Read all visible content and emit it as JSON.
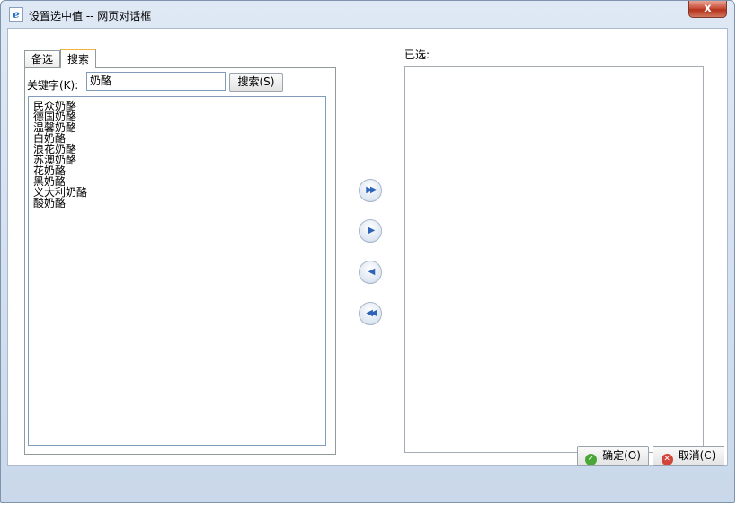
{
  "window": {
    "title": "设置选中值 -- 网页对话框",
    "close_glyph": "x"
  },
  "tabs": [
    {
      "label": "备选"
    },
    {
      "label": "搜索"
    }
  ],
  "search": {
    "keyword_label": "关键字(K):",
    "keyword_value": "奶酪",
    "button_label": "搜索(S)"
  },
  "available_items": [
    "民众奶酪",
    "德国奶酪",
    "温馨奶酪",
    "白奶酪",
    "浪花奶酪",
    "苏澳奶酪",
    "花奶酪",
    "黑奶酪",
    "义大利奶酪",
    "酸奶酪"
  ],
  "selected": {
    "label": "已选:"
  },
  "move_buttons": {
    "add_all": "▶▶",
    "add": "▶",
    "remove": "◀",
    "remove_all": "◀◀"
  },
  "footer": {
    "ok_label": "确定(O)",
    "cancel_label": "取消(C)"
  },
  "icons": {
    "ok": "check-circle-icon",
    "cancel": "x-circle-icon",
    "app": "ie-icon"
  }
}
